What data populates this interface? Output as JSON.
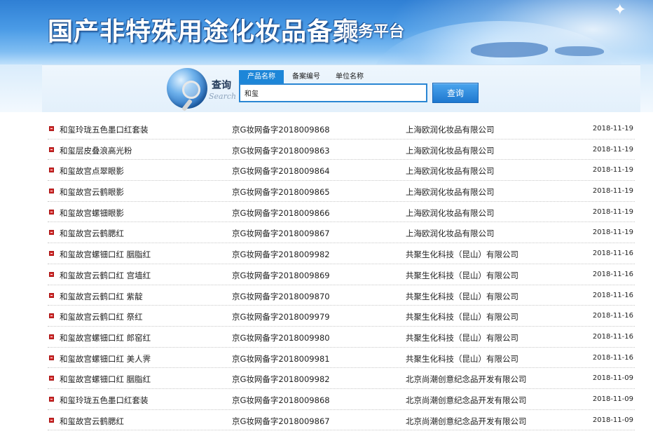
{
  "header": {
    "title": "国产非特殊用途化妆品备案",
    "subtitle": "服务平台"
  },
  "search": {
    "logo_cn": "查询",
    "logo_en": "Search",
    "tabs": [
      {
        "label": "产品名称",
        "active": true
      },
      {
        "label": "备案编号",
        "active": false
      },
      {
        "label": "单位名称",
        "active": false
      }
    ],
    "query": "和玺",
    "button_label": "查询"
  },
  "colors": {
    "accent": "#1d86d8",
    "bullet": "#d12a2a"
  },
  "results": [
    {
      "name": "和玺玲珑五色墨口红套装",
      "code": "京G妆网备字2018009868",
      "company": "上海欧润化妆品有限公司",
      "date": "2018-11-19"
    },
    {
      "name": "和玺层皮叠浪高光粉",
      "code": "京G妆网备字2018009863",
      "company": "上海欧润化妆品有限公司",
      "date": "2018-11-19"
    },
    {
      "name": "和玺故宫点翠眼影",
      "code": "京G妆网备字2018009864",
      "company": "上海欧润化妆品有限公司",
      "date": "2018-11-19"
    },
    {
      "name": "和玺故宫云鹤眼影",
      "code": "京G妆网备字2018009865",
      "company": "上海欧润化妆品有限公司",
      "date": "2018-11-19"
    },
    {
      "name": "和玺故宫螺钿眼影",
      "code": "京G妆网备字2018009866",
      "company": "上海欧润化妆品有限公司",
      "date": "2018-11-19"
    },
    {
      "name": "和玺故宫云鹤腮红",
      "code": "京G妆网备字2018009867",
      "company": "上海欧润化妆品有限公司",
      "date": "2018-11-19"
    },
    {
      "name": "和玺故宫螺钿口红 胭脂红",
      "code": "京G妆网备字2018009982",
      "company": "共聚生化科技（昆山）有限公司",
      "date": "2018-11-16"
    },
    {
      "name": "和玺故宫云鹤口红 宫墙红",
      "code": "京G妆网备字2018009869",
      "company": "共聚生化科技（昆山）有限公司",
      "date": "2018-11-16"
    },
    {
      "name": "和玺故宫云鹤口红 紫靛",
      "code": "京G妆网备字2018009870",
      "company": "共聚生化科技（昆山）有限公司",
      "date": "2018-11-16"
    },
    {
      "name": "和玺故宫云鹤口红 祭红",
      "code": "京G妆网备字2018009979",
      "company": "共聚生化科技（昆山）有限公司",
      "date": "2018-11-16"
    },
    {
      "name": "和玺故宫螺钿口红 郎窑红",
      "code": "京G妆网备字2018009980",
      "company": "共聚生化科技（昆山）有限公司",
      "date": "2018-11-16"
    },
    {
      "name": "和玺故宫螺钿口红 美人霁",
      "code": "京G妆网备字2018009981",
      "company": "共聚生化科技（昆山）有限公司",
      "date": "2018-11-16"
    },
    {
      "name": "和玺故宫螺钿口红 胭脂红",
      "code": "京G妆网备字2018009982",
      "company": "北京尚潮创意纪念品开发有限公司",
      "date": "2018-11-09"
    },
    {
      "name": "和玺玲珑五色墨口红套装",
      "code": "京G妆网备字2018009868",
      "company": "北京尚潮创意纪念品开发有限公司",
      "date": "2018-11-09"
    },
    {
      "name": "和玺故宫云鹤腮红",
      "code": "京G妆网备字2018009867",
      "company": "北京尚潮创意纪念品开发有限公司",
      "date": "2018-11-09"
    }
  ]
}
